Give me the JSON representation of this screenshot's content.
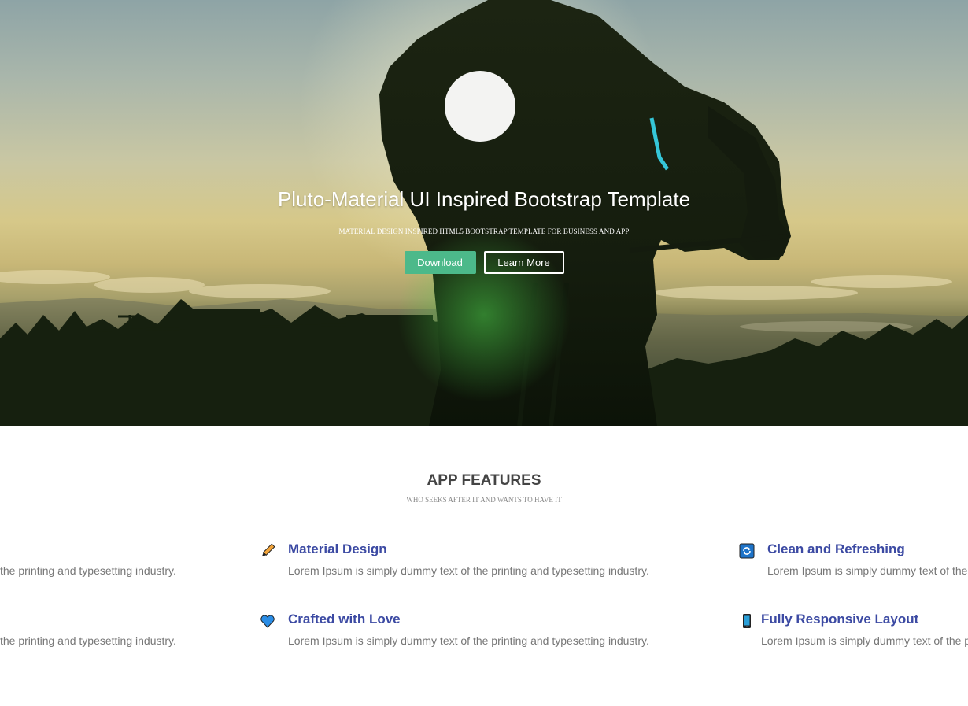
{
  "hero": {
    "title": "Pluto-Material UI Inspired Bootstrap Template",
    "subtitle": "MATERIAL DESIGN INSPIRED HTML5 BOOTSTRAP TEMPLATE FOR BUSINESS AND APP",
    "download_label": "Download",
    "learn_more_label": "Learn More",
    "colors": {
      "download_bg": "#4cb98a",
      "text": "#ffffff"
    }
  },
  "features": {
    "title": "APP FEATURES",
    "subtitle": "WHO SEEKS AFTER IT AND WANTS TO HAVE IT",
    "left_partial": [
      "the printing and typesetting industry.",
      "the printing and typesetting industry."
    ],
    "items": [
      {
        "icon": "pencil-icon",
        "title": "Material Design",
        "text": "Lorem Ipsum is simply dummy text of the printing and typesetting industry."
      },
      {
        "icon": "refresh-icon",
        "title": "Clean and Refreshing",
        "text": "Lorem Ipsum is simply dummy text of the printing and typesetting industry."
      },
      {
        "icon": "heart-icon",
        "title": "Crafted with Love",
        "text": "Lorem Ipsum is simply dummy text of the printing and typesetting industry."
      },
      {
        "icon": "mobile-icon",
        "title": "Fully Responsive Layout",
        "text": "Lorem Ipsum is simply dummy text of the printing and typesetting industry."
      }
    ],
    "colors": {
      "title": "#3c4aa3",
      "text": "#777777"
    }
  }
}
